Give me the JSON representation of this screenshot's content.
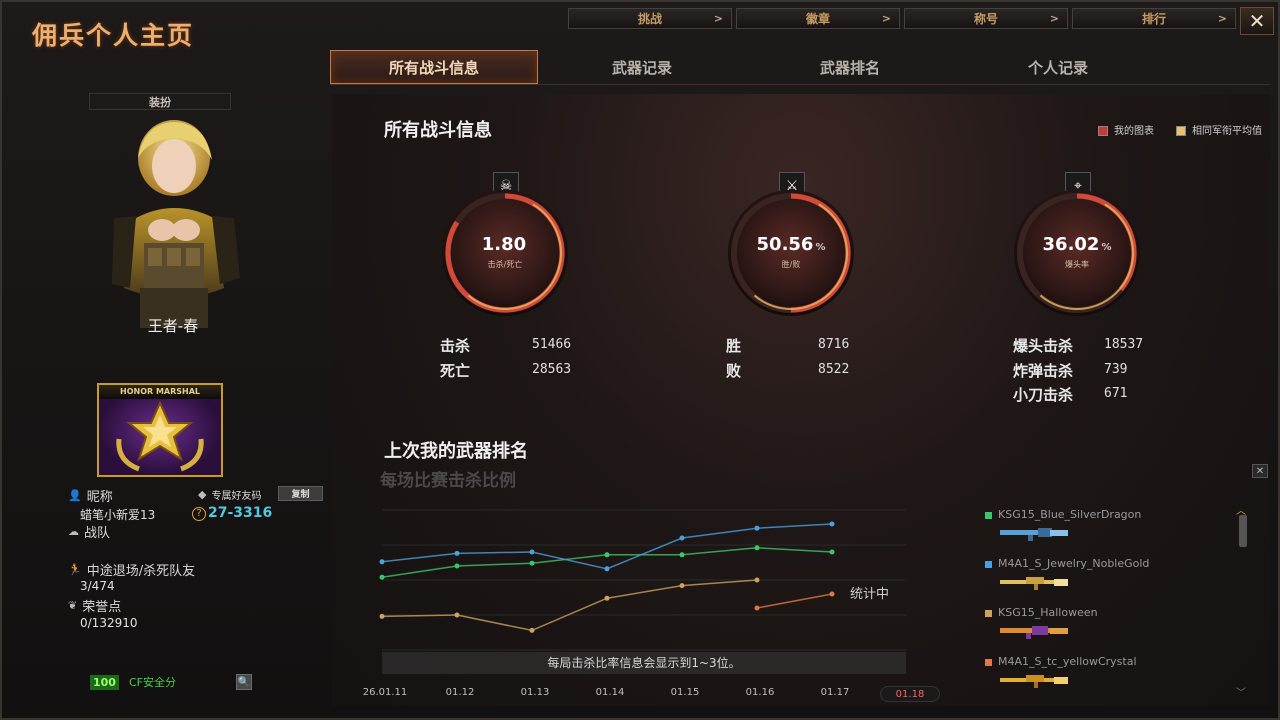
{
  "app_title": "佣兵个人主页",
  "top_menu": [
    {
      "label": "挑战"
    },
    {
      "label": "徽章"
    },
    {
      "label": "称号"
    },
    {
      "label": "排行"
    }
  ],
  "tabs": [
    {
      "label": "所有战斗信息",
      "active": true
    },
    {
      "label": "武器记录"
    },
    {
      "label": "武器排名"
    },
    {
      "label": "个人记录"
    }
  ],
  "left": {
    "dress_label": "装扮",
    "character_name": "王者-春",
    "badge_title": "HONOR MARSHAL",
    "nickname_label": "昵称",
    "friend_code_label": "专属好友码",
    "copy_label": "复制",
    "nickname": "蜡笔小新爱13",
    "friend_code": "27-3316",
    "team_label": "战队",
    "quit_label": "中途退场/杀死队友",
    "quit_value": "3/474",
    "honor_label": "荣誉点",
    "honor_value": "0/132910",
    "safety_score": "100",
    "safety_label": "CF安全分"
  },
  "main": {
    "section_title": "所有战斗信息",
    "legend": [
      {
        "label": "我的图表",
        "color": "#c83a3a"
      },
      {
        "label": "相同军衔平均值",
        "color": "#e8c070"
      }
    ],
    "stats": [
      {
        "value": "1.80",
        "unit": "",
        "label": "击杀/死亡",
        "fill": 0.84
      },
      {
        "value": "50.56",
        "unit": "%",
        "label": "胜/败",
        "fill": 0.5
      },
      {
        "value": "36.02",
        "unit": "%",
        "label": "爆头率",
        "fill": 0.36
      }
    ],
    "kill_label": "击杀",
    "kill_value": "51466",
    "death_label": "死亡",
    "death_value": "28563",
    "win_label": "胜",
    "win_value": "8716",
    "lose_label": "败",
    "lose_value": "8522",
    "hs_label": "爆头击杀",
    "hs_value": "18537",
    "bomb_label": "炸弹击杀",
    "bomb_value": "739",
    "knife_label": "小刀击杀",
    "knife_value": "671"
  },
  "weapon_section": {
    "title": "上次我的武器排名",
    "subtitle": "每场比赛击杀比例",
    "counting": "统计中",
    "note": "每局击杀比率信息会显示到1~3位。",
    "dates": [
      "26.01.11",
      "01.12",
      "01.13",
      "01.14",
      "01.15",
      "01.16",
      "01.17",
      "01.18"
    ],
    "active_date_index": 7,
    "weapons": [
      {
        "name": "KSG15_Blue_SilverDragon",
        "color": "#3ec46a"
      },
      {
        "name": "M4A1_S_Jewelry_NobleGold",
        "color": "#4aa0e0"
      },
      {
        "name": "KSG15_Halloween",
        "color": "#d0a060"
      },
      {
        "name": "M4A1_S_tc_yellowCrystal",
        "color": "#e07848"
      }
    ]
  },
  "chart_data": {
    "type": "line",
    "categories": [
      "26.01.11",
      "01.12",
      "01.13",
      "01.14",
      "01.15",
      "01.16",
      "01.17",
      "01.18"
    ],
    "ylim": [
      0,
      1
    ],
    "series": [
      {
        "name": "KSG15_Blue_SilverDragon",
        "color": "#3ec46a",
        "values": [
          0.52,
          0.6,
          0.62,
          0.68,
          0.68,
          0.73,
          0.7,
          null
        ]
      },
      {
        "name": "M4A1_S_Jewelry_NobleGold",
        "color": "#4aa0e0",
        "values": [
          0.63,
          0.69,
          0.7,
          0.58,
          0.8,
          0.87,
          0.9,
          null
        ]
      },
      {
        "name": "KSG15_Halloween",
        "color": "#d0a060",
        "values": [
          0.24,
          0.25,
          0.14,
          0.37,
          0.46,
          0.5,
          null,
          null
        ]
      },
      {
        "name": "M4A1_S_tc_yellowCrystal",
        "color": "#e07848",
        "values": [
          null,
          null,
          null,
          null,
          null,
          0.3,
          0.4,
          null
        ]
      }
    ]
  }
}
